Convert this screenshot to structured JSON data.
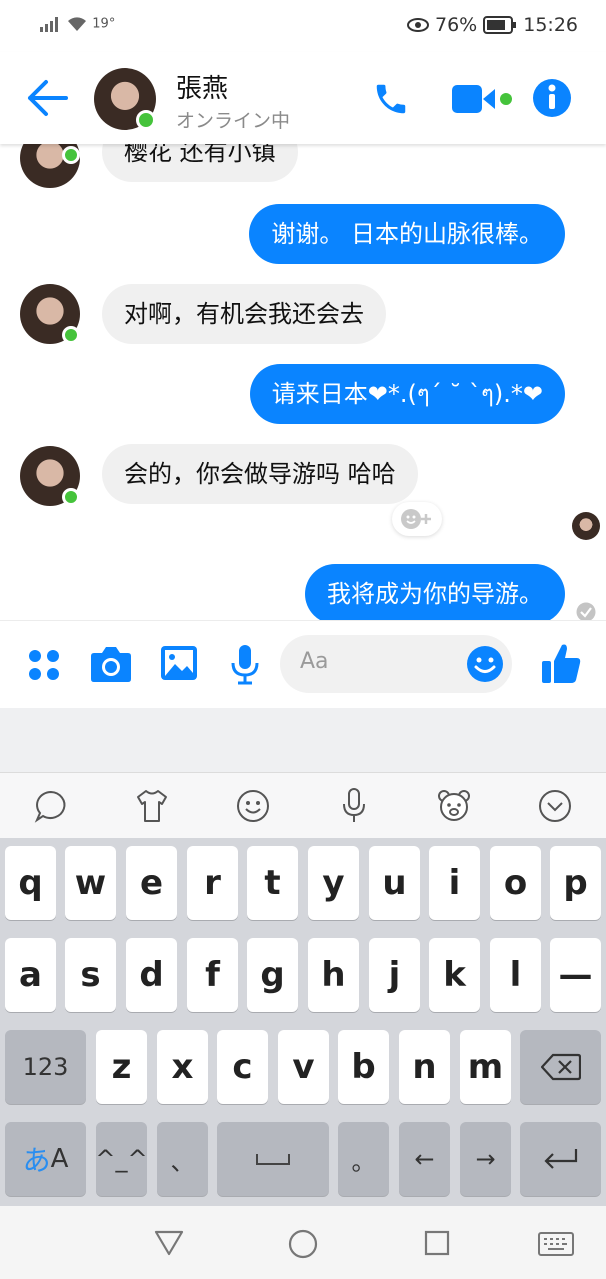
{
  "status": {
    "signal": "19°",
    "battery": "76%",
    "time": "15:26"
  },
  "header": {
    "name": "張燕",
    "status": "オンライン中"
  },
  "messages": [
    {
      "side": "in",
      "text": "樱花 还有小镇"
    },
    {
      "side": "out",
      "text": "谢谢。 日本的山脉很棒。"
    },
    {
      "side": "in",
      "text": "对啊，有机会我还会去"
    },
    {
      "side": "out",
      "text": "请来日本❤*.(ๆ´ ˘ `ๆ).*❤"
    },
    {
      "side": "in",
      "text": "会的，你会做导游吗 哈哈"
    },
    {
      "side": "out",
      "text": "我将成为你的导游。"
    }
  ],
  "composer": {
    "placeholder": "Aa"
  },
  "keyboard": {
    "row1": [
      "q",
      "w",
      "e",
      "r",
      "t",
      "y",
      "u",
      "i",
      "o",
      "p"
    ],
    "row2": [
      "a",
      "s",
      "d",
      "f",
      "g",
      "h",
      "j",
      "k",
      "l",
      "—"
    ],
    "row3": [
      "z",
      "x",
      "c",
      "v",
      "b",
      "n",
      "m"
    ],
    "num_label": "123",
    "kana_label_a": "あ",
    "kana_label_b": "A",
    "emoticon_label": "^_^",
    "comma_label": "、",
    "period_label": "。",
    "left_arrow": "←",
    "right_arrow": "→"
  },
  "colors": {
    "accent": "#0a84ff",
    "online": "#45c33b"
  }
}
